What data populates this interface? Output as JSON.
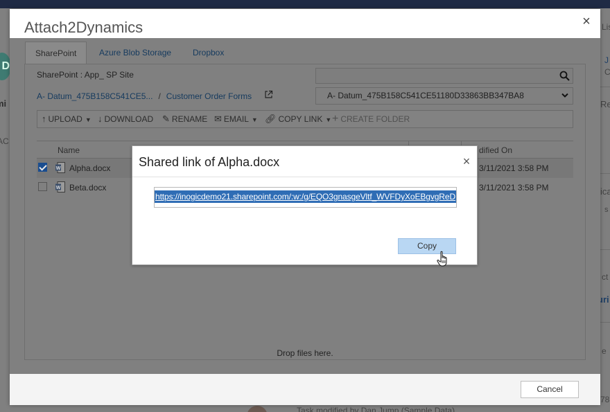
{
  "background": {
    "avatar_letter": "D",
    "fragments_left": [
      "mi",
      "AC"
    ],
    "fragments_right": [
      "Lis",
      "J",
      "C",
      "Re",
      "ica",
      "s",
      "ct",
      "uri",
      "e",
      "78"
    ],
    "timeline_text": "Task modified by Dan Jump (Sample Data)"
  },
  "dialog": {
    "title": "Attach2Dynamics",
    "tabs": [
      {
        "label": "SharePoint",
        "active": true
      },
      {
        "label": "Azure Blob Storage",
        "active": false
      },
      {
        "label": "Dropbox",
        "active": false
      }
    ],
    "site_label": "SharePoint : App_ SP Site",
    "search_placeholder": "",
    "breadcrumb": {
      "first": "A- Datum_475B158C541CE5...",
      "separator": "/",
      "second": "Customer Order Forms"
    },
    "folder_select_value": "A- Datum_475B158C541CE51180D33863BB347BA8",
    "toolbar": {
      "upload": "UPLOAD",
      "download": "DOWNLOAD",
      "rename": "RENAME",
      "email": "EMAIL",
      "copy_link": "COPY LINK",
      "create_folder": "CREATE FOLDER"
    },
    "grid": {
      "headers": {
        "name": "Name",
        "modified": "dified On"
      },
      "rows": [
        {
          "name": "Alpha.docx",
          "modified": "3/11/2021 3:58 PM",
          "checked": true
        },
        {
          "name": "Beta.docx",
          "modified": "3/11/2021 3:58 PM",
          "checked": false
        }
      ]
    },
    "drop_text": "Drop files here.",
    "cancel_label": "Cancel",
    "close_symbol": "×"
  },
  "modal": {
    "title": "Shared link of Alpha.docx",
    "close_symbol": "×",
    "link_text": "https://inogicdemo21.sharepoint.com/:w:/g/EQO3gnasgeVltf_WVFDyXoEBgvgReD",
    "copy_label": "Copy"
  },
  "colors": {
    "accent": "#2f6db5",
    "copy_button": "#b9d7f3",
    "overlay": "#808080",
    "link": "#153a5e"
  }
}
